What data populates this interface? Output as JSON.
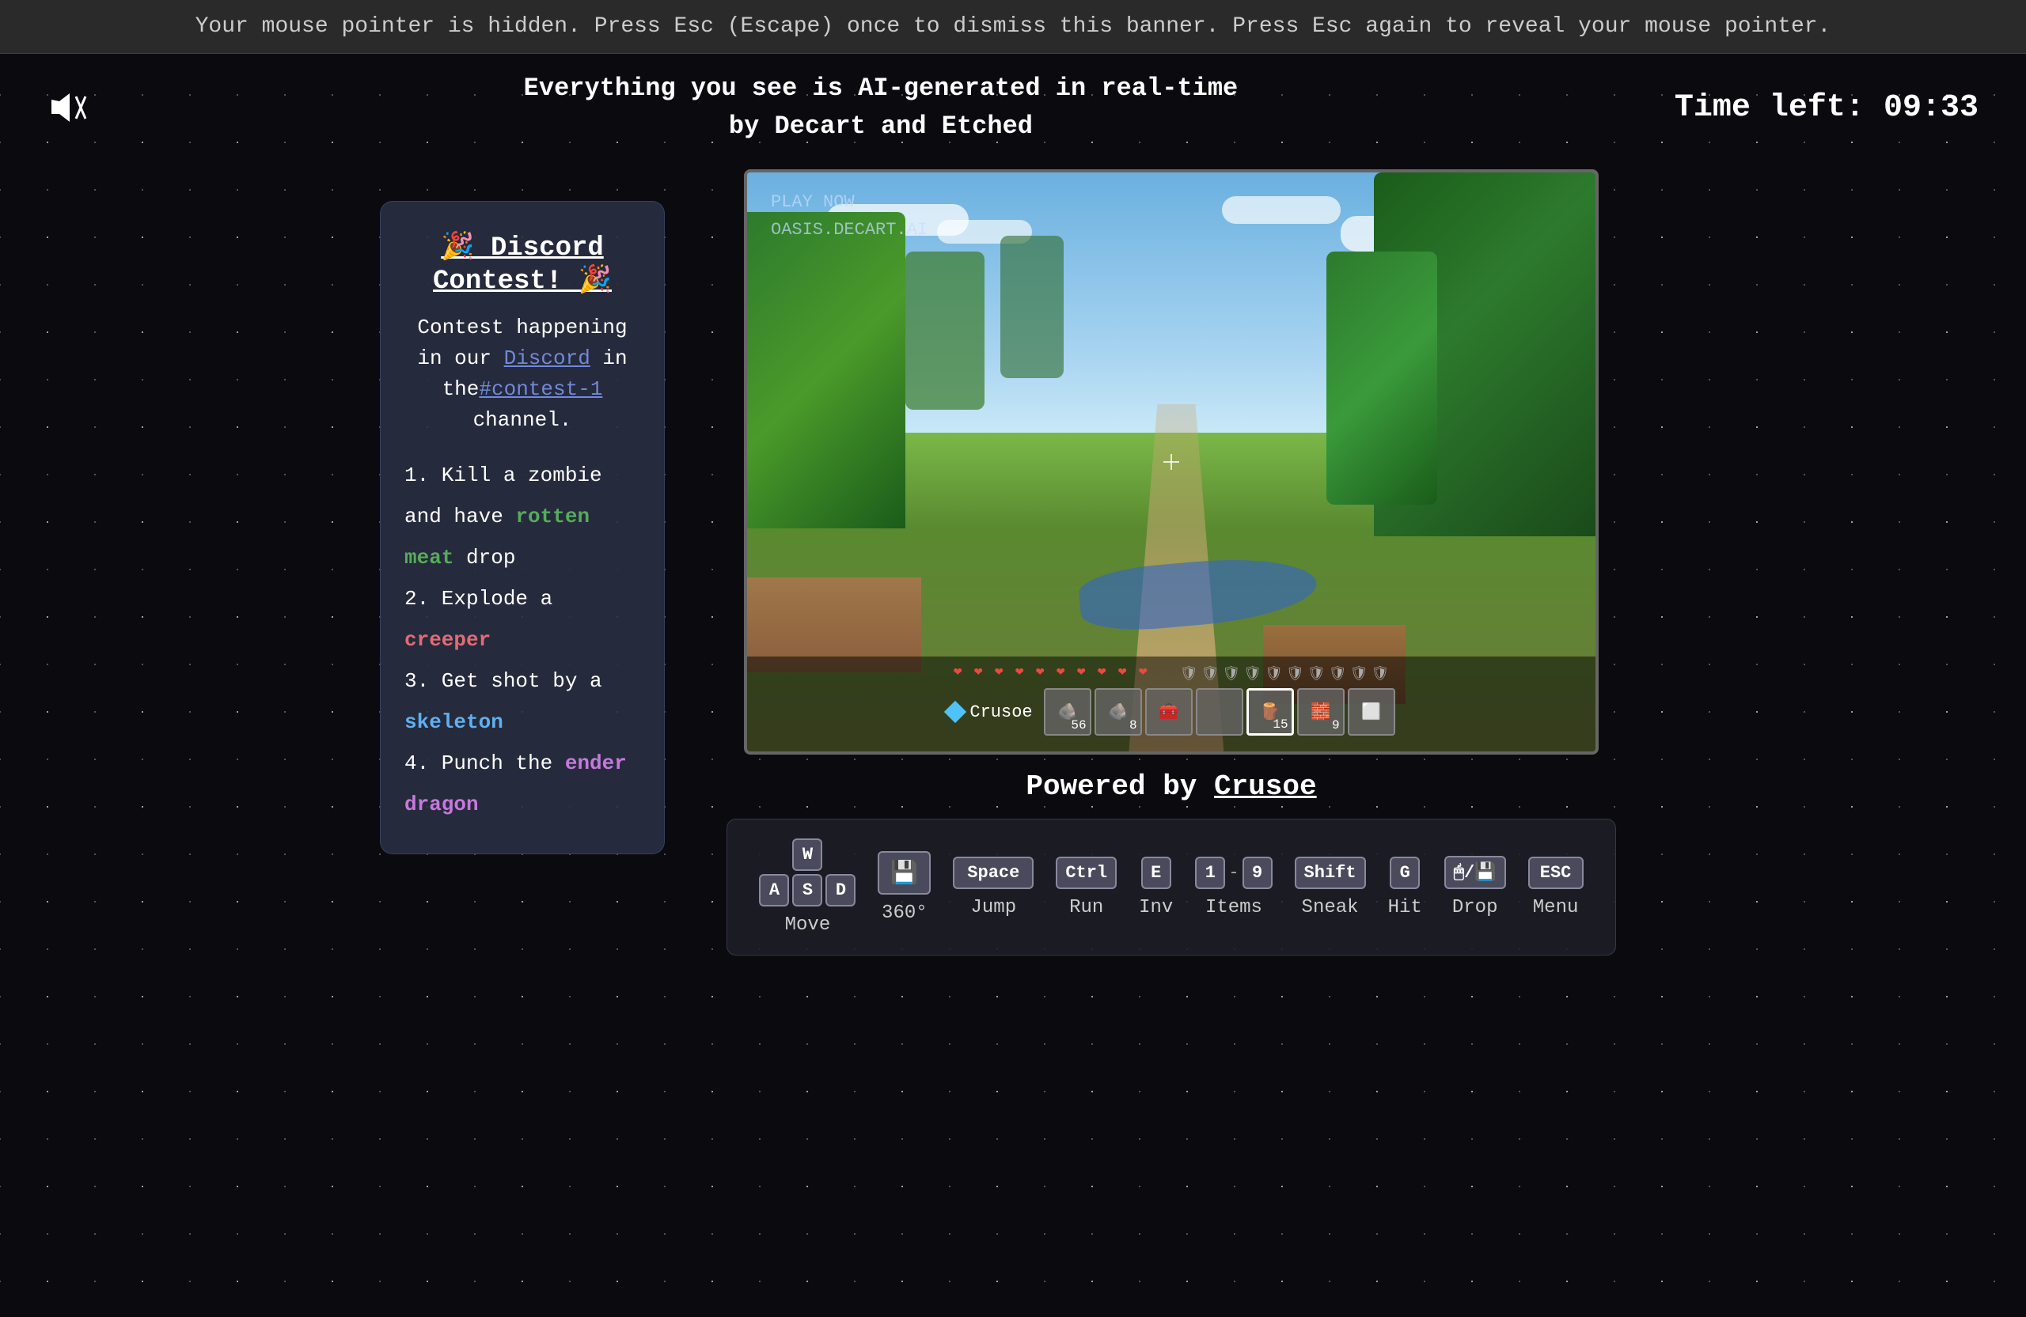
{
  "banner": {
    "text": "Your mouse pointer is hidden. Press Esc (Escape) once to dismiss this banner. Press Esc again to reveal your mouse pointer."
  },
  "header": {
    "subtitle_line1": "Everything you see is AI-generated in real-time",
    "subtitle_line2": "by Decart and Etched",
    "timer_label": "Time left:",
    "timer_value": "09:33"
  },
  "discord_panel": {
    "title": "🎉 Discord Contest! 🎉",
    "description_prefix": "Contest happening in our ",
    "discord_link_text": "Discord",
    "description_middle": " in the",
    "channel_link_text": "#contest-1",
    "description_suffix": " channel.",
    "tasks": [
      {
        "num": "1.",
        "prefix": "Kill a zombie and have ",
        "highlight": "rotten meat",
        "suffix": " drop",
        "color": "green"
      },
      {
        "num": "2.",
        "prefix": "Explode a ",
        "highlight": "creeper",
        "suffix": "",
        "color": "red"
      },
      {
        "num": "3.",
        "prefix": "Get shot by a ",
        "highlight": "skeleton",
        "suffix": "",
        "color": "blue"
      },
      {
        "num": "4.",
        "prefix": "Punch the ",
        "highlight": "ender dragon",
        "suffix": "",
        "color": "purple"
      }
    ]
  },
  "game": {
    "play_now_line1": "PLAY NOW",
    "play_now_line2": "OASIS.DECART.AI",
    "player_name": "Crusoe",
    "hotbar_items": [
      "🪨",
      "🪨",
      "🧰",
      "",
      "🪵",
      "🧱",
      "🔲"
    ],
    "hotbar_counts": [
      "56",
      "8",
      "",
      "",
      "15",
      "9",
      ""
    ]
  },
  "powered_by": {
    "text": "Powered by ",
    "link": "Crusoe"
  },
  "controls": [
    {
      "keys": [
        "W",
        "A",
        "S",
        "D"
      ],
      "label": "Move",
      "type": "wasd"
    },
    {
      "keys": [
        "💾"
      ],
      "label": "360°",
      "type": "icon"
    },
    {
      "keys": [
        "Space"
      ],
      "label": "Jump",
      "type": "single-wide"
    },
    {
      "keys": [
        "Ctrl"
      ],
      "label": "Run",
      "type": "single-medium"
    },
    {
      "keys": [
        "E"
      ],
      "label": "Inv",
      "type": "single"
    },
    {
      "keys": [
        "1",
        "9"
      ],
      "label": "Items",
      "type": "range"
    },
    {
      "keys": [
        "Shift"
      ],
      "label": "Sneak",
      "type": "single-medium"
    },
    {
      "keys": [
        "G"
      ],
      "label": "Hit",
      "type": "single"
    },
    {
      "keys": [
        "💾"
      ],
      "label": "Drop",
      "type": "icon2"
    },
    {
      "keys": [
        "ESC"
      ],
      "label": "Menu",
      "type": "single-medium"
    }
  ]
}
